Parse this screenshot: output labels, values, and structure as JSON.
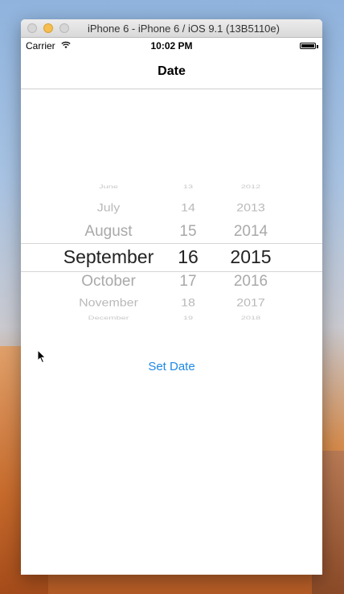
{
  "window": {
    "title": "iPhone 6 - iPhone 6 / iOS 9.1 (13B5110e)"
  },
  "status_bar": {
    "carrier": "Carrier",
    "time": "10:02 PM"
  },
  "nav": {
    "title": "Date"
  },
  "picker": {
    "months": [
      "June",
      "July",
      "August",
      "September",
      "October",
      "November",
      "December"
    ],
    "days": [
      "13",
      "14",
      "15",
      "16",
      "17",
      "18",
      "19"
    ],
    "years": [
      "2012",
      "2013",
      "2014",
      "2015",
      "2016",
      "2017",
      "2018"
    ],
    "selected": {
      "month": "September",
      "day": "16",
      "year": "2015"
    }
  },
  "actions": {
    "set_date": "Set Date"
  },
  "colors": {
    "accent": "#1e88e5",
    "selected_text": "#222222",
    "dim_text": "#a9a9a9"
  }
}
